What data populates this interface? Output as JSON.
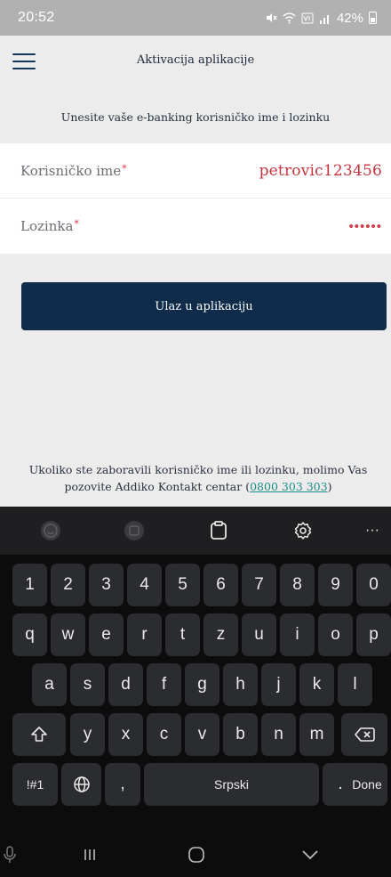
{
  "status_bar": {
    "time": "20:52",
    "battery": "42%"
  },
  "header": {
    "title": "Aktivacija aplikacije"
  },
  "instruction": "Unesite vaše e-banking korisničko ime i lozinku",
  "form": {
    "username_label": "Korisničko ime",
    "username_value": "petrovic123456",
    "password_label": "Lozinka",
    "password_value": "••••••",
    "required_mark": "*"
  },
  "login_button": "Ulaz u aplikaciju",
  "forgot": {
    "text": "Ukoliko ste zaboravili korisničko ime ili lozinku, molimo Vas pozovite Addiko Kontakt centar (",
    "phone": "0800 303 303",
    "close": ")"
  },
  "toolbar": {
    "icons": [
      "emoji-icon",
      "sticker-icon",
      "clipboard-icon",
      "settings-icon",
      "more-icon"
    ],
    "more": "···"
  },
  "keyboard": {
    "row_numbers": [
      "1",
      "2",
      "3",
      "4",
      "5",
      "6",
      "7",
      "8",
      "9",
      "0"
    ],
    "row_q": [
      "q",
      "w",
      "e",
      "r",
      "t",
      "z",
      "u",
      "i",
      "o",
      "p"
    ],
    "row_a": [
      "a",
      "s",
      "d",
      "f",
      "g",
      "h",
      "j",
      "k",
      "l"
    ],
    "row_y": [
      "y",
      "x",
      "c",
      "v",
      "b",
      "n",
      "m"
    ],
    "symbols": "!#1",
    "comma": ",",
    "space": "Srpski",
    "period": ".",
    "done": "Done"
  },
  "colors": {
    "primary": "#0f2d4b",
    "error": "#c7333f",
    "link": "#1a8f8a"
  }
}
